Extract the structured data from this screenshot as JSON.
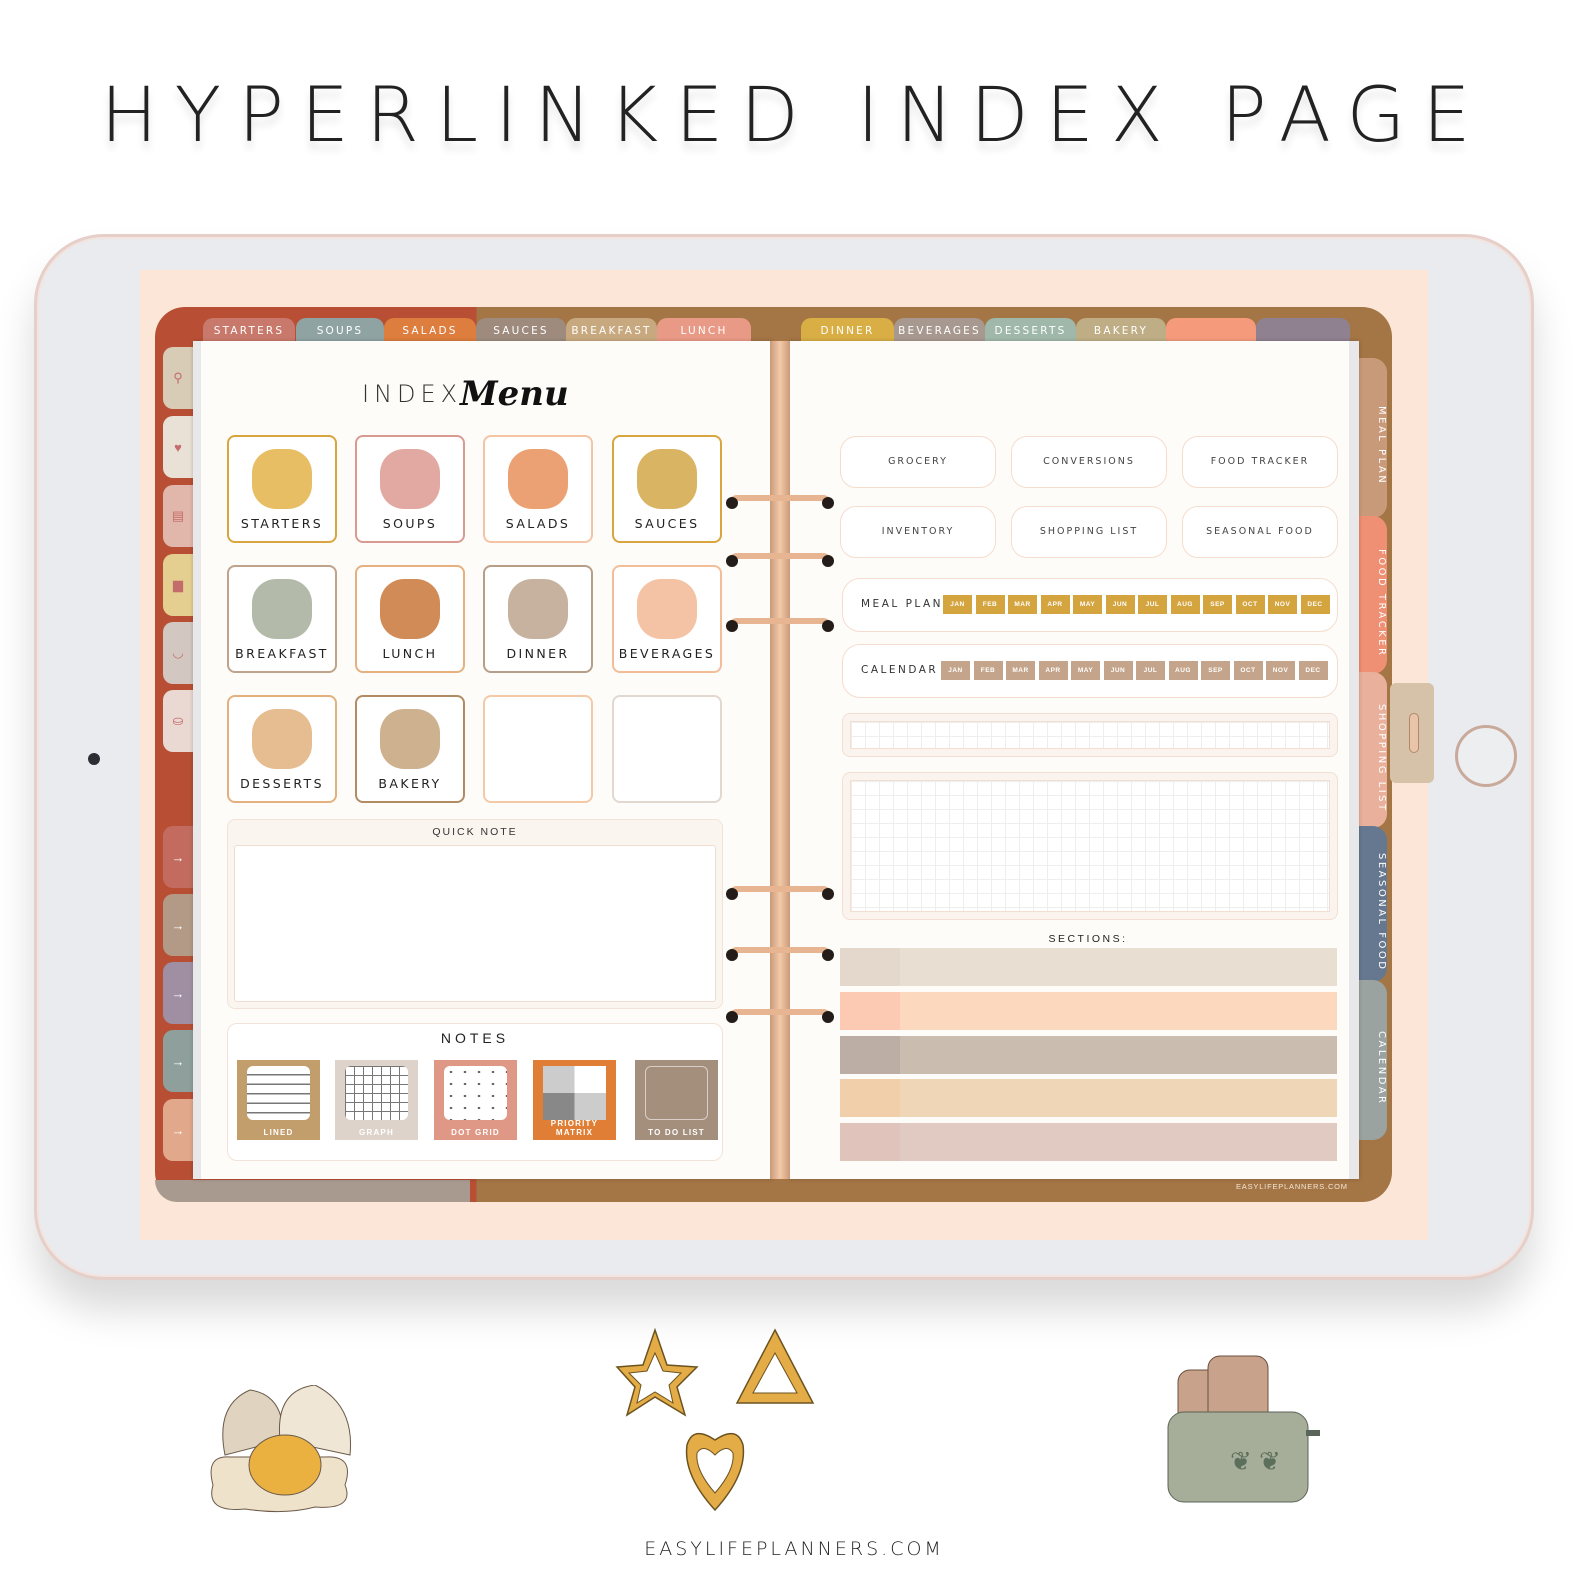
{
  "headline": "HYPERLINKED INDEX PAGE",
  "colors": {
    "binder_leather_left": "#b84f34",
    "binder_leather_right": "#a47545",
    "screen_bg": "#fce6d8",
    "page_bg": "#fdfcf9",
    "meal_plan_chip": "#d4a43f",
    "calendar_chip": "#c4a48a"
  },
  "top_tabs": [
    {
      "label": "STARTERS",
      "color": "#c9796b"
    },
    {
      "label": "SOUPS",
      "color": "#8fa3a3"
    },
    {
      "label": "SALADS",
      "color": "#dd7d3e"
    },
    {
      "label": "SAUCES",
      "color": "#9e8b7e"
    },
    {
      "label": "BREAKFAST",
      "color": "#c8a97f"
    },
    {
      "label": "LUNCH",
      "color": "#e99a86"
    },
    {
      "label": "DINNER",
      "color": "#d9ae44"
    },
    {
      "label": "BEVERAGES",
      "color": "#a89990"
    },
    {
      "label": "DESSERTS",
      "color": "#9fb8aa"
    },
    {
      "label": "BAKERY",
      "color": "#bfae85"
    },
    {
      "label": "",
      "color": "#f59b7c"
    },
    {
      "label": "",
      "color": "#8f8190"
    }
  ],
  "left_side_tabs": [
    {
      "icon": "search-icon",
      "glyph": "⚲",
      "color": "#d9ccb6"
    },
    {
      "icon": "heart-icon",
      "glyph": "♥",
      "color": "#e9e1d5"
    },
    {
      "icon": "notebook-icon",
      "glyph": "▤",
      "color": "#e2b7ab"
    },
    {
      "icon": "toast-icon",
      "glyph": "▆",
      "color": "#e4cf90"
    },
    {
      "icon": "measuring-cup-icon",
      "glyph": "◡",
      "color": "#d3c7c1"
    },
    {
      "icon": "grocery-bag-icon",
      "glyph": "⛀",
      "color": "#ead8d2"
    },
    {
      "icon": "arrow-right-icon",
      "glyph": "→",
      "color": "#c26b5e"
    },
    {
      "icon": "arrow-right-icon",
      "glyph": "→",
      "color": "#b29a87"
    },
    {
      "icon": "arrow-right-icon",
      "glyph": "→",
      "color": "#a08fa3"
    },
    {
      "icon": "arrow-right-icon",
      "glyph": "→",
      "color": "#8e9f9c"
    },
    {
      "icon": "arrow-right-icon",
      "glyph": "→",
      "color": "#e2a88b"
    }
  ],
  "right_side_tabs": [
    {
      "label": "MEAL PLAN",
      "color": "#c99a7a"
    },
    {
      "label": "FOOD TRACKER",
      "color": "#ef8f73"
    },
    {
      "label": "SHOPPING LIST",
      "color": "#e9b09c"
    },
    {
      "label": "SEASONAL FOOD",
      "color": "#66788f"
    },
    {
      "label": "CALENDAR",
      "color": "#9aa39f"
    }
  ],
  "index": {
    "title": "INDEX",
    "title_script": "Menu",
    "categories": [
      {
        "label": "STARTERS",
        "icon": "cheese-icon",
        "border": "#d9a53f"
      },
      {
        "label": "SOUPS",
        "icon": "soup-pot-icon",
        "border": "#d99a92"
      },
      {
        "label": "SALADS",
        "icon": "salad-bowl-icon",
        "border": "#f4c4a4"
      },
      {
        "label": "SAUCES",
        "icon": "oil-bottle-icon",
        "border": "#d9a53f"
      },
      {
        "label": "BREAKFAST",
        "icon": "toaster-icon",
        "border": "#bfa38a"
      },
      {
        "label": "LUNCH",
        "icon": "burger-icon",
        "border": "#e6b07f"
      },
      {
        "label": "DINNER",
        "icon": "cloche-icon",
        "border": "#b79e88"
      },
      {
        "label": "BEVERAGES",
        "icon": "wine-glass-icon",
        "border": "#f3bd98"
      },
      {
        "label": "DESSERTS",
        "icon": "cake-icon",
        "border": "#e4b07d"
      },
      {
        "label": "BAKERY",
        "icon": "croissant-icon",
        "border": "#b18c63"
      },
      {
        "label": "",
        "icon": "",
        "border": "#f4c9a7"
      },
      {
        "label": "",
        "icon": "",
        "border": "#e2d8d0"
      }
    ],
    "quick_note": {
      "title": "QUICK NOTE",
      "value": ""
    },
    "notes": {
      "title": "NOTES",
      "items": [
        {
          "label": "LINED",
          "color": "#c39e6d",
          "icon": "lined-paper-icon"
        },
        {
          "label": "GRAPH",
          "color": "#ddd3cb",
          "icon": "graph-paper-icon"
        },
        {
          "label": "DOT GRID",
          "color": "#e09886",
          "icon": "dot-grid-icon"
        },
        {
          "label": "PRIORITY MATRIX",
          "color": "#e17e35",
          "icon": "priority-matrix-icon"
        },
        {
          "label": "TO DO LIST",
          "color": "#a48f7d",
          "icon": "todo-list-icon"
        }
      ]
    }
  },
  "right_page": {
    "links": [
      {
        "label": "GROCERY"
      },
      {
        "label": "CONVERSIONS"
      },
      {
        "label": "FOOD TRACKER"
      },
      {
        "label": "INVENTORY"
      },
      {
        "label": "SHOPPING LIST"
      },
      {
        "label": "SEASONAL FOOD"
      }
    ],
    "meal_plan": {
      "label": "MEAL PLAN"
    },
    "calendar": {
      "label": "CALENDAR"
    },
    "months": [
      "JAN",
      "FEB",
      "MAR",
      "APR",
      "MAY",
      "JUN",
      "JUL",
      "AUG",
      "SEP",
      "OCT",
      "NOV",
      "DEC"
    ],
    "sections_title": "SECTIONS:",
    "sections": [
      {
        "swatch": "#e3d8cb",
        "bar": "#e8dfd2"
      },
      {
        "swatch": "#fcc9b2",
        "bar": "#fcd8bf"
      },
      {
        "swatch": "#bdaea5",
        "bar": "#cbbcb0"
      },
      {
        "swatch": "#f1cfaa",
        "bar": "#efd6b7"
      },
      {
        "swatch": "#e0c4bb",
        "bar": "#e0cac2"
      }
    ],
    "brand": "EASYLIFEPLANNERS.COM"
  },
  "bottom_brand": "EASYLIFEPLANNERS.COM"
}
